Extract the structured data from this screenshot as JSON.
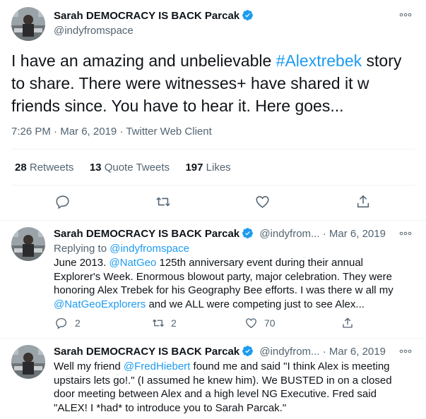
{
  "main_tweet": {
    "author_name": "Sarah DEMOCRACY IS BACK Parcak",
    "handle": "@indyfromspace",
    "text_before": "I have an amazing and unbelievable ",
    "hashtag": "#Alextrebek",
    "text_after": " story to share. There were witnesses+ have shared it w friends since. You have to hear it. Here goes...",
    "time": "7:26 PM",
    "date": "Mar 6, 2019",
    "source": "Twitter Web Client",
    "retweets_count": "28",
    "retweets_label": "Retweets",
    "quotes_count": "13",
    "quotes_label": "Quote Tweets",
    "likes_count": "197",
    "likes_label": "Likes"
  },
  "reply1": {
    "author_name": "Sarah DEMOCRACY IS BACK Parcak",
    "handle": "@indyfrom...",
    "date": "Mar 6, 2019",
    "replying_label": "Replying to ",
    "replying_handle": "@indyfromspace",
    "t1": "June 2013. ",
    "m1": "@NatGeo",
    "t2": " 125th anniversary event during their annual Explorer's Week. Enormous blowout party, major celebration. They were honoring Alex Trebek for his Geography Bee efforts. I was there w all my ",
    "m2": "@NatGeoExplorers",
    "t3": " and we ALL were competing just to see Alex...",
    "replies": "2",
    "retweets": "2",
    "likes": "70"
  },
  "reply2": {
    "author_name": "Sarah DEMOCRACY IS BACK Parcak",
    "handle": "@indyfrom...",
    "date": "Mar 6, 2019",
    "t1": "Well my friend ",
    "m1": "@FredHiebert",
    "t2": " found me and said \"I think Alex is meeting upstairs lets go!.\" (I assumed he knew him). We BUSTED in on a closed door meeting between Alex and a high level NG Executive. Fred said \"ALEX! I *had* to introduce you to Sarah Parcak.\""
  },
  "separator": "·",
  "colors": {
    "accent": "#1d9bf0",
    "muted": "#536471",
    "text": "#0f1419"
  }
}
